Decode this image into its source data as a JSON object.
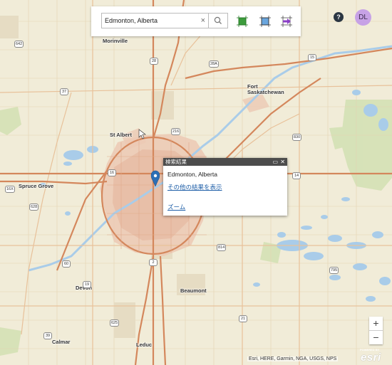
{
  "search": {
    "value": "Edmonton, Alberta",
    "clear_icon": "×"
  },
  "toolbar": {
    "help_label": "?",
    "user_initials": "DL"
  },
  "map_labels": {
    "morinville": "Morinville",
    "fort_saskatchewan": "Fort\nSaskatchewan",
    "st_albert": "St Albert",
    "spruce_grove": "Spruce Grove",
    "devon": "Devon",
    "beaumont": "Beaumont",
    "calmar": "Calmar",
    "leduc": "Leduc"
  },
  "highway_shields": {
    "h642": "642",
    "h28": "28",
    "h28a": "28A",
    "h15": "15",
    "h37": "37",
    "h216": "216",
    "h16x": "16X",
    "h16": "16",
    "h628": "628",
    "h60": "60",
    "h625": "625",
    "h2": "2",
    "h21": "21",
    "h14": "14",
    "h19": "19",
    "h814": "814",
    "h830": "830",
    "h39": "39",
    "h795": "795"
  },
  "popup": {
    "title": "検索結果",
    "result_name": "Edmonton, Alberta",
    "more_results_link": "その他の結果を表示",
    "zoom_link": "ズーム",
    "maximize_icon": "▭",
    "close_icon": "✕"
  },
  "zoom_controls": {
    "in_label": "+",
    "out_label": "−"
  },
  "attribution": "Esri, HERE, Garmin, NGA, USGS, NPS",
  "logo": {
    "powered_by": "POWERED BY",
    "brand": "esri"
  },
  "colors": {
    "land": "#f1ecd8",
    "water": "#a9cce9",
    "highway": "#d4875c",
    "road": "#e8c19a",
    "urban": "#ecc9b4",
    "marker": "#2c6fb6"
  }
}
